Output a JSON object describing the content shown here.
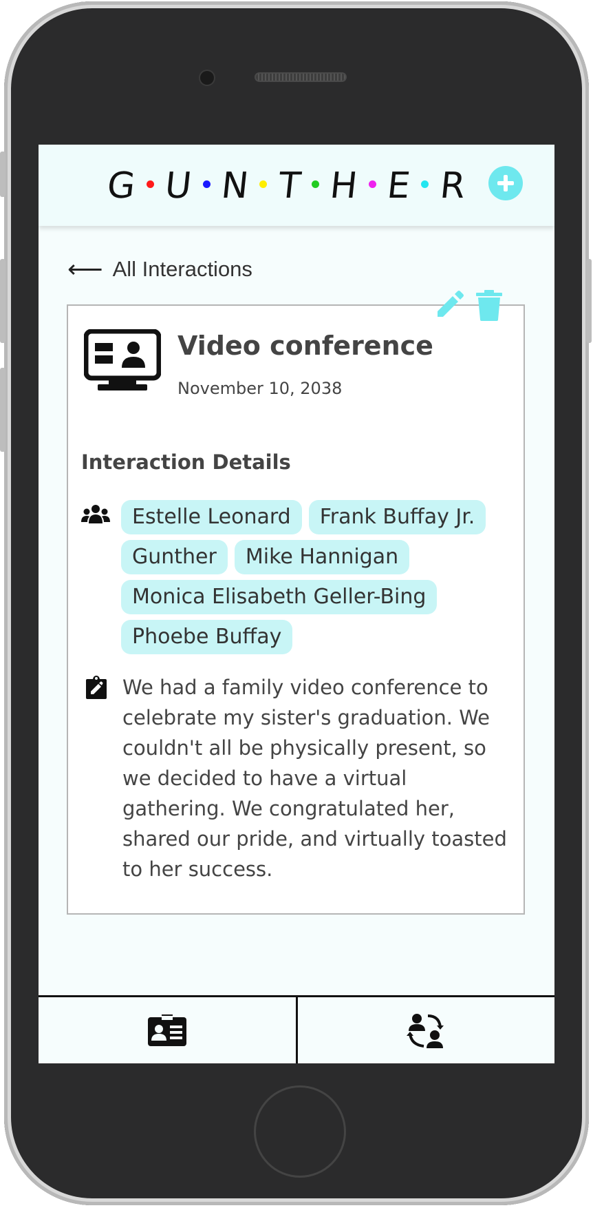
{
  "app": {
    "logo_letters": [
      "G",
      "U",
      "N",
      "T",
      "H",
      "E",
      "R"
    ],
    "logo_dot_colors": [
      "#ff1a1a",
      "#1a1aff",
      "#ffee00",
      "#22cc22",
      "#ee22ee",
      "#22e6f0"
    ],
    "accent_color": "#6ee8ee",
    "add_icon": "plus-icon"
  },
  "back_link": {
    "label": "All Interactions",
    "icon": "arrow-left-icon"
  },
  "interaction": {
    "type_icon": "video-conference-icon",
    "title": "Video conference",
    "date": "November 10, 2038",
    "actions": {
      "edit_icon": "pencil-icon",
      "delete_icon": "trash-icon"
    },
    "details_heading": "Interaction Details",
    "participants_icon": "people-group-icon",
    "participants": [
      "Estelle Leonard",
      "Frank Buffay Jr.",
      "Gunther",
      "Mike Hannigan",
      "Monica Elisabeth Geller-Bing",
      "Phoebe Buffay"
    ],
    "notes_icon": "clipboard-pen-icon",
    "notes": "We had a family video conference to celebrate my sister's graduation. We couldn't all be physically present, so we decided to have a virtual gathering. We congratulated her, shared our pride, and virtually toasted to her success."
  },
  "bottom_nav": {
    "tabs": [
      {
        "icon": "contact-card-icon"
      },
      {
        "icon": "people-interaction-icon"
      }
    ]
  }
}
